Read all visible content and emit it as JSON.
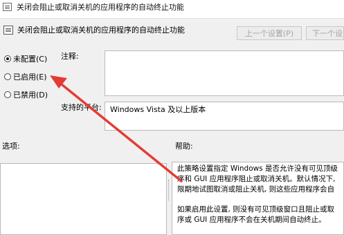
{
  "window": {
    "title": "关闭会阻止或取消关机的应用程序的自动终止功能"
  },
  "header": {
    "title": "关闭会阻止或取消关机的应用程序的自动终止功能"
  },
  "nav": {
    "prev_label": "上一个设置(P)",
    "next_label": "下一个设"
  },
  "state": {
    "options": [
      {
        "label": "未配置(C)",
        "checked": true
      },
      {
        "label": "已启用(E)",
        "checked": false
      },
      {
        "label": "已禁用(D)",
        "checked": false
      }
    ]
  },
  "comment": {
    "label": "注释:",
    "value": ""
  },
  "platform": {
    "label": "支持的平台:",
    "value": "Windows Vista 及以上版本"
  },
  "options_panel": {
    "label": "选项:"
  },
  "help": {
    "label": "帮助:",
    "lines": [
      "此策略设置指定 Windows 是否允许没有可见顶级",
      "序和 GUI 应用程序阻止或取消关机。默认情况下,",
      "限期地试图取消或阻止关机, 则这些应用程序会自",
      "如果启用此设置, 则没有可见顶级窗口且阻止或取",
      "序或 GUI 应用程序不会在关机期间自动终止。"
    ]
  },
  "annotation": {
    "arrow_color": "#e53b35"
  },
  "icons": [
    "policy-icon",
    "policy-icon"
  ]
}
